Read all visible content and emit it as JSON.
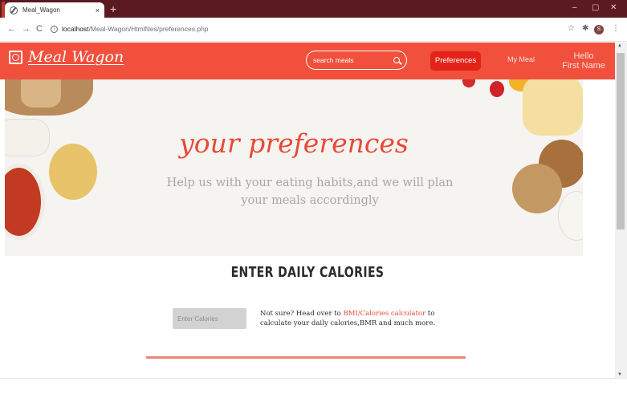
{
  "browser": {
    "tab_title": "Meal_Wagon",
    "tab_close": "×",
    "new_tab": "+",
    "url_host": "localhost",
    "url_path": "/Meal-Wagon/Htmlfiles/preferences.php",
    "profile_initial": "S",
    "window_controls": [
      "–",
      "▢",
      "✕"
    ]
  },
  "navbar": {
    "brand": "Meal Wagon",
    "search_placeholder": "search meals",
    "preferences_label": "Preferences",
    "my_meal_label": "My Meal",
    "hello_line1": "Hello",
    "hello_line2": "First Name",
    "accent_color": "#f0503c",
    "active_button_color": "#e32317"
  },
  "hero": {
    "title": "your preferences",
    "subtitle": "Help us with your eating habits,and we will plan your meals accordingly"
  },
  "calories": {
    "heading": "ENTER DAILY CALORIES",
    "input_placeholder": "Enter Calories",
    "note_prefix": "Not sure? Head over to ",
    "note_link": "BMI/Calories calculator",
    "note_suffix": " to calculate your daily calories,BMR and much more."
  },
  "icons": [
    "back-icon",
    "forward-icon",
    "reload-icon",
    "info-icon",
    "star-icon",
    "extensions-icon",
    "menu-icon",
    "search-icon",
    "logo-icon"
  ]
}
